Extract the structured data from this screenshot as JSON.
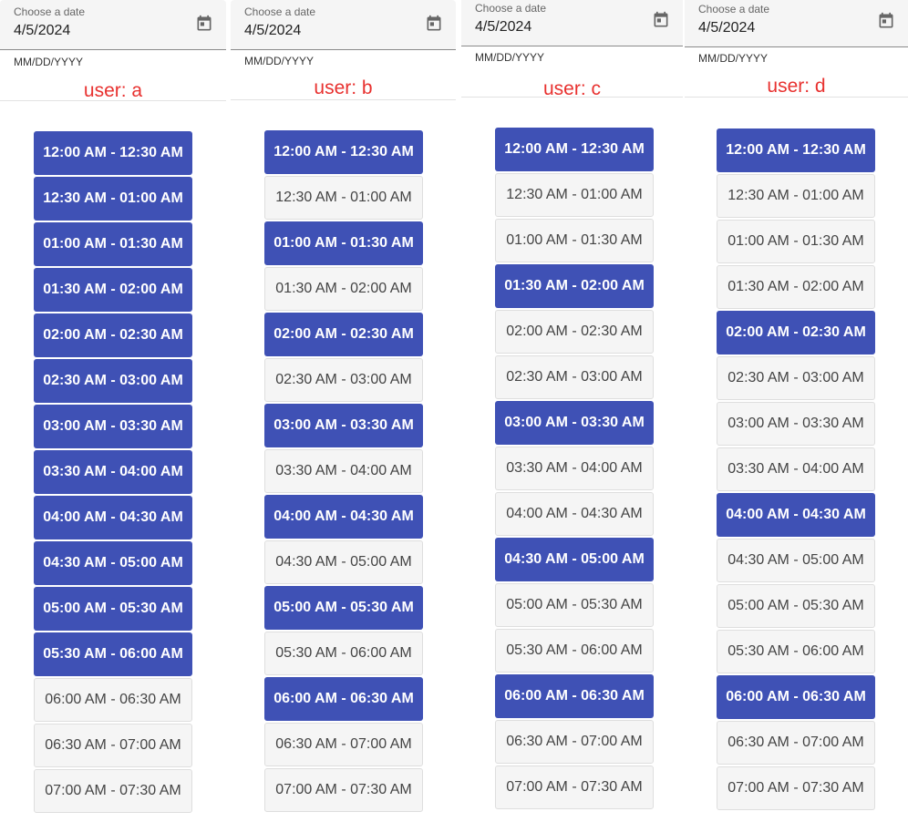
{
  "accent_color": "#3f51b5",
  "annotation_color": "#e8312f",
  "time_slots": [
    "12:00 AM - 12:30 AM",
    "12:30 AM - 01:00 AM",
    "01:00 AM - 01:30 AM",
    "01:30 AM - 02:00 AM",
    "02:00 AM - 02:30 AM",
    "02:30 AM - 03:00 AM",
    "03:00 AM - 03:30 AM",
    "03:30 AM - 04:00 AM",
    "04:00 AM - 04:30 AM",
    "04:30 AM - 05:00 AM",
    "05:00 AM - 05:30 AM",
    "05:30 AM - 06:00 AM",
    "06:00 AM - 06:30 AM",
    "06:30 AM - 07:00 AM",
    "07:00 AM - 07:30 AM"
  ],
  "panels": [
    {
      "field_label": "Choose a date",
      "field_value": "4/5/2024",
      "hint": "MM/DD/YYYY",
      "user_label": "user: a",
      "calendar_icon": "calendar-icon",
      "selected": [
        0,
        1,
        2,
        3,
        4,
        5,
        6,
        7,
        8,
        9,
        10,
        11
      ]
    },
    {
      "field_label": "Choose a date",
      "field_value": "4/5/2024",
      "hint": "MM/DD/YYYY",
      "user_label": "user: b",
      "calendar_icon": "calendar-icon",
      "selected": [
        0,
        2,
        4,
        6,
        8,
        10,
        12
      ]
    },
    {
      "field_label": "Choose a date",
      "field_value": "4/5/2024",
      "hint": "MM/DD/YYYY",
      "user_label": "user: c",
      "calendar_icon": "calendar-icon",
      "selected": [
        0,
        3,
        6,
        9,
        12
      ]
    },
    {
      "field_label": "Choose a date",
      "field_value": "4/5/2024",
      "hint": "MM/DD/YYYY",
      "user_label": "user: d",
      "calendar_icon": "calendar-icon",
      "selected": [
        0,
        4,
        8,
        12
      ]
    }
  ]
}
